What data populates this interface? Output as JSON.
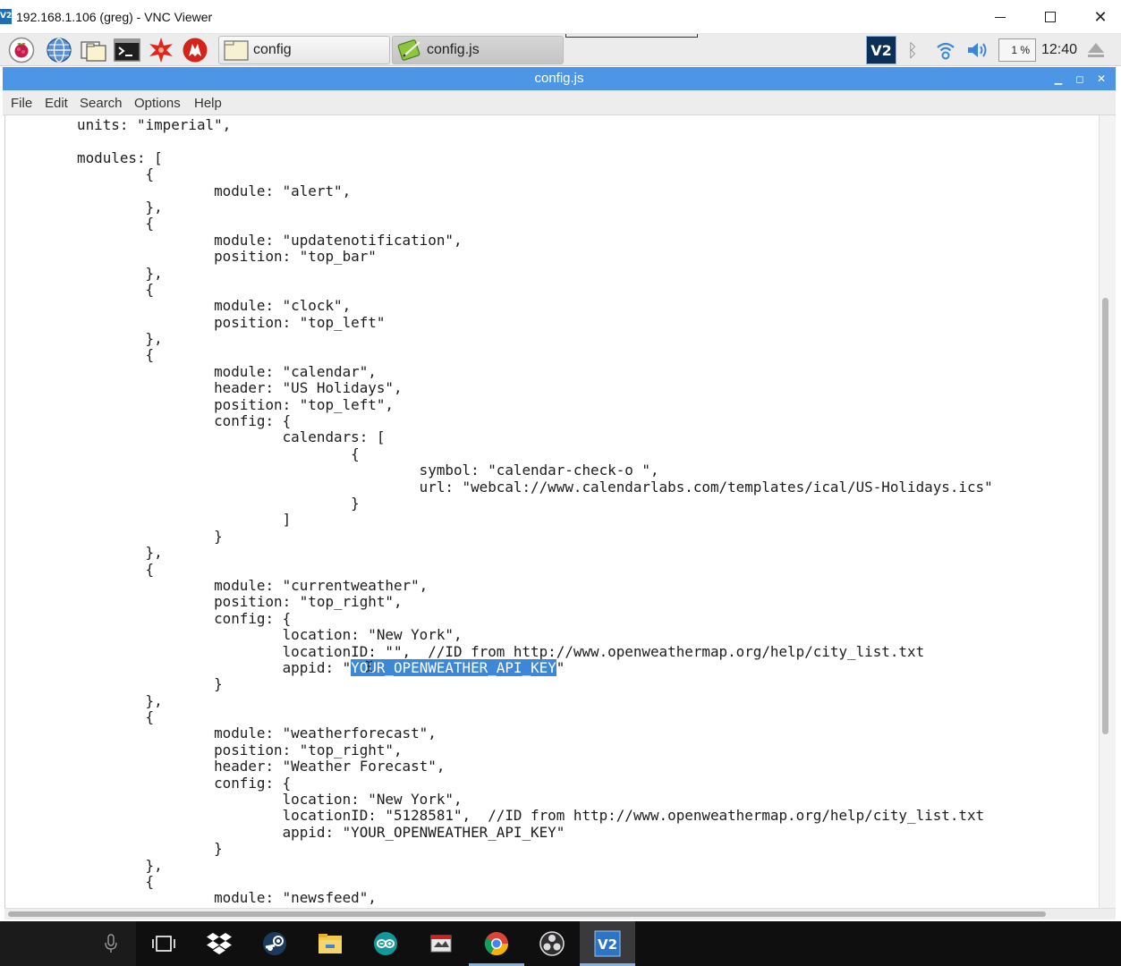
{
  "window": {
    "title": "192.168.1.106 (greg) - VNC Viewer",
    "logo_text": "V2",
    "controls": [
      "minimize",
      "maximize",
      "close"
    ]
  },
  "pi_panel": {
    "launchers": [
      "raspberry-menu-icon",
      "web-browser-icon",
      "file-manager-icon",
      "terminal-icon",
      "mathematica-icon",
      "wolfram-icon"
    ],
    "tasks": [
      {
        "label": "config",
        "icon": "folder-icon",
        "active": false
      },
      {
        "label": "config.js",
        "icon": "text-editor-icon",
        "active": true
      }
    ],
    "tray": {
      "vnc_label": "V2",
      "bluetooth_icon": "bluetooth-icon",
      "wifi_icon": "wifi-icon",
      "volume_icon": "volume-icon",
      "cpu_percent": "1 %",
      "clock": "12:40",
      "eject_icon": "eject-icon"
    }
  },
  "editor": {
    "title": "config.js",
    "menu": [
      "File",
      "Edit",
      "Search",
      "Options",
      "Help"
    ],
    "lines": [
      "units: \"imperial\",",
      "",
      "modules: [",
      "        {",
      "                module: \"alert\",",
      "        },",
      "        {",
      "                module: \"updatenotification\",",
      "                position: \"top_bar\"",
      "        },",
      "        {",
      "                module: \"clock\",",
      "                position: \"top_left\"",
      "        },",
      "        {",
      "                module: \"calendar\",",
      "                header: \"US Holidays\",",
      "                position: \"top_left\",",
      "                config: {",
      "                        calendars: [",
      "                                {",
      "                                        symbol: \"calendar-check-o \",",
      "                                        url: \"webcal://www.calendarlabs.com/templates/ical/US-Holidays.ics\"",
      "                                }",
      "                        ]",
      "                }",
      "        },",
      "        {",
      "                module: \"currentweather\",",
      "                position: \"top_right\",",
      "                config: {",
      "                        location: \"New York\",",
      "                        locationID: \"\",  //ID from http://www.openweathermap.org/help/city_list.txt",
      "                        appid: \"YOUR_OPENWEATHER_API_KEY\"",
      "                }",
      "        },",
      "        {",
      "                module: \"weatherforecast\",",
      "                position: \"top_right\",",
      "                header: \"Weather Forecast\",",
      "                config: {",
      "                        location: \"New York\",",
      "                        locationID: \"5128581\",  //ID from http://www.openweathermap.org/help/city_list.txt",
      "                        appid: \"YOUR_OPENWEATHER_API_KEY\"",
      "                }",
      "        },",
      "        {",
      "                module: \"newsfeed\","
    ],
    "selection": {
      "line_index": 33,
      "prefix": "                        appid: \"",
      "selected_text": "YOUR_OPENWEATHER_API_KEY",
      "suffix": "\""
    }
  },
  "taskbar": {
    "items": [
      {
        "icon": "microphone-icon",
        "active": false
      },
      {
        "icon": "task-view-icon",
        "active": false
      },
      {
        "icon": "dropbox-icon",
        "active": false
      },
      {
        "icon": "steam-icon",
        "active": false
      },
      {
        "icon": "file-explorer-icon",
        "active": false
      },
      {
        "icon": "arduino-icon",
        "active": false
      },
      {
        "icon": "app-icon",
        "active": false
      },
      {
        "icon": "chrome-icon",
        "active": true
      },
      {
        "icon": "obs-icon",
        "active": false
      },
      {
        "icon": "vnc-viewer-icon",
        "active": true
      }
    ],
    "vnc_label": "V2"
  }
}
